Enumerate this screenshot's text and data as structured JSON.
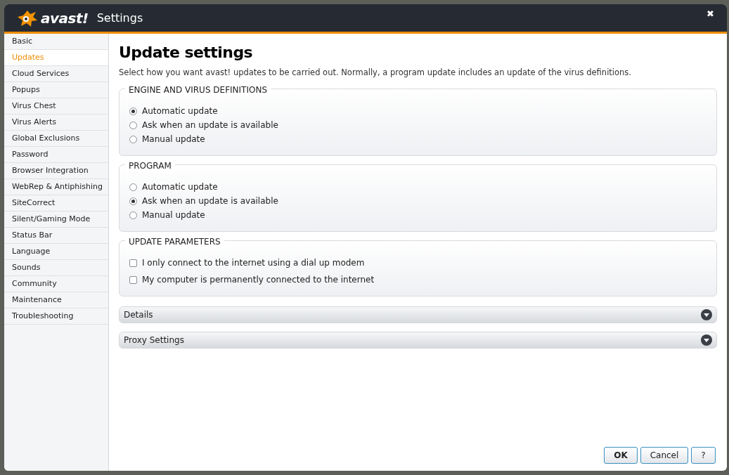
{
  "window": {
    "logo": "avast!",
    "title": "Settings",
    "close": "✖"
  },
  "sidebar": {
    "items": [
      {
        "label": "Basic",
        "selected": false
      },
      {
        "label": "Updates",
        "selected": true
      },
      {
        "label": "Cloud Services",
        "selected": false
      },
      {
        "label": "Popups",
        "selected": false
      },
      {
        "label": "Virus Chest",
        "selected": false
      },
      {
        "label": "Virus Alerts",
        "selected": false
      },
      {
        "label": "Global Exclusions",
        "selected": false
      },
      {
        "label": "Password",
        "selected": false
      },
      {
        "label": "Browser Integration",
        "selected": false
      },
      {
        "label": "WebRep & Antiphishing",
        "selected": false
      },
      {
        "label": "SiteCorrect",
        "selected": false
      },
      {
        "label": "Silent/Gaming Mode",
        "selected": false
      },
      {
        "label": "Status Bar",
        "selected": false
      },
      {
        "label": "Language",
        "selected": false
      },
      {
        "label": "Sounds",
        "selected": false
      },
      {
        "label": "Community",
        "selected": false
      },
      {
        "label": "Maintenance",
        "selected": false
      },
      {
        "label": "Troubleshooting",
        "selected": false
      }
    ]
  },
  "heading": "Update settings",
  "description": "Select how you want avast! updates to be carried out. Normally, a program update includes an update of the virus definitions.",
  "groups": [
    {
      "title": "ENGINE AND VIRUS DEFINITIONS",
      "kind": "radio",
      "options": [
        {
          "label": "Automatic update",
          "selected": true
        },
        {
          "label": "Ask when an update is available",
          "selected": false
        },
        {
          "label": "Manual update",
          "selected": false
        }
      ]
    },
    {
      "title": "PROGRAM",
      "kind": "radio",
      "options": [
        {
          "label": "Automatic update",
          "selected": false
        },
        {
          "label": "Ask when an update is available",
          "selected": true
        },
        {
          "label": "Manual update",
          "selected": false
        }
      ]
    },
    {
      "title": "UPDATE PARAMETERS",
      "kind": "checkbox",
      "options": [
        {
          "label": "I only connect to the internet using a dial up modem",
          "checked": false
        },
        {
          "label": "My computer is permanently connected to the internet",
          "checked": false
        }
      ]
    }
  ],
  "expanders": [
    {
      "label": "Details",
      "expanded": false
    },
    {
      "label": "Proxy Settings",
      "expanded": false
    }
  ],
  "buttons": [
    {
      "label": "OK",
      "kind": "primary"
    },
    {
      "label": "Cancel",
      "kind": "normal"
    },
    {
      "label": "?",
      "kind": "help"
    }
  ]
}
